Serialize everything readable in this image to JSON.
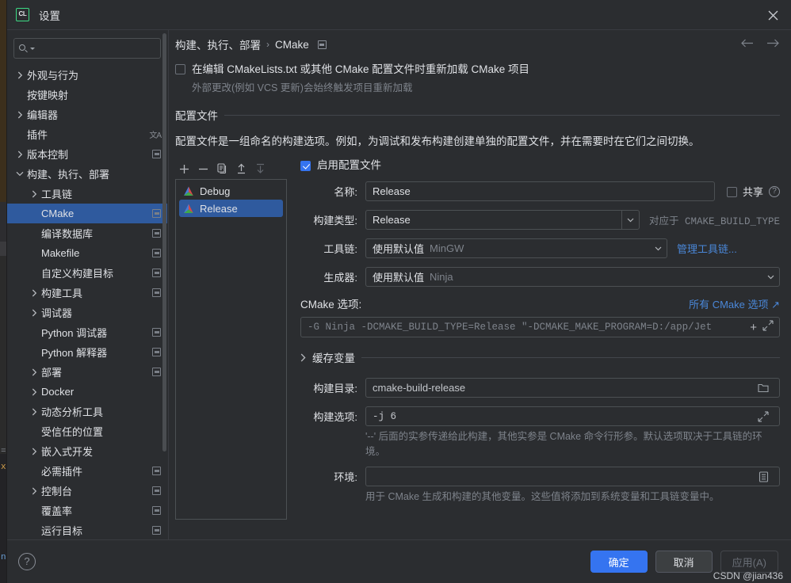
{
  "window": {
    "title": "设置",
    "logo_text": "CL",
    "close_icon": "close-icon"
  },
  "sidebar": {
    "search": {
      "placeholder": "",
      "value": ""
    },
    "items": [
      {
        "label": "外观与行为",
        "indent": 0,
        "arrow": "collapsed",
        "badge": false
      },
      {
        "label": "按键映射",
        "indent": 0,
        "arrow": "none",
        "badge": false
      },
      {
        "label": "编辑器",
        "indent": 0,
        "arrow": "collapsed",
        "badge": false
      },
      {
        "label": "插件",
        "indent": 0,
        "arrow": "none",
        "badge": false,
        "lang_badge": "文A"
      },
      {
        "label": "版本控制",
        "indent": 0,
        "arrow": "collapsed",
        "badge": true
      },
      {
        "label": "构建、执行、部署",
        "indent": 0,
        "arrow": "expanded",
        "badge": false
      },
      {
        "label": "工具链",
        "indent": 1,
        "arrow": "collapsed",
        "badge": false
      },
      {
        "label": "CMake",
        "indent": 1,
        "arrow": "none",
        "badge": true,
        "selected": true
      },
      {
        "label": "编译数据库",
        "indent": 1,
        "arrow": "none",
        "badge": true
      },
      {
        "label": "Makefile",
        "indent": 1,
        "arrow": "none",
        "badge": true
      },
      {
        "label": "自定义构建目标",
        "indent": 1,
        "arrow": "none",
        "badge": true
      },
      {
        "label": "构建工具",
        "indent": 1,
        "arrow": "collapsed",
        "badge": true
      },
      {
        "label": "调试器",
        "indent": 1,
        "arrow": "collapsed",
        "badge": false
      },
      {
        "label": "Python 调试器",
        "indent": 1,
        "arrow": "none",
        "badge": true
      },
      {
        "label": "Python 解释器",
        "indent": 1,
        "arrow": "none",
        "badge": true
      },
      {
        "label": "部署",
        "indent": 1,
        "arrow": "collapsed",
        "badge": true
      },
      {
        "label": "Docker",
        "indent": 1,
        "arrow": "collapsed",
        "badge": false
      },
      {
        "label": "动态分析工具",
        "indent": 1,
        "arrow": "collapsed",
        "badge": false
      },
      {
        "label": "受信任的位置",
        "indent": 1,
        "arrow": "none",
        "badge": false
      },
      {
        "label": "嵌入式开发",
        "indent": 1,
        "arrow": "collapsed",
        "badge": false
      },
      {
        "label": "必需插件",
        "indent": 1,
        "arrow": "none",
        "badge": true
      },
      {
        "label": "控制台",
        "indent": 1,
        "arrow": "collapsed",
        "badge": true
      },
      {
        "label": "覆盖率",
        "indent": 1,
        "arrow": "none",
        "badge": true
      },
      {
        "label": "运行目标",
        "indent": 1,
        "arrow": "none",
        "badge": true
      }
    ]
  },
  "breadcrumb": {
    "parent": "构建、执行、部署",
    "separator": "›",
    "current": "CMake",
    "back_icon": "arrow-left-icon",
    "forward_icon": "arrow-right-icon"
  },
  "main": {
    "reload_checkbox": {
      "label": "在编辑 CMakeLists.txt 或其他 CMake 配置文件时重新加载 CMake 项目",
      "checked": false,
      "note": "外部更改(例如 VCS 更新)会始终触发项目重新加载"
    },
    "section": {
      "title": "配置文件",
      "description": "配置文件是一组命名的构建选项。例如，为调试和发布构建创建单独的配置文件，并在需要时在它们之间切换。"
    },
    "toolbar": {
      "add": "+",
      "remove": "−",
      "copy": "copy-icon",
      "move_up": "arrow-up-icon",
      "move_down": "arrow-down-icon"
    },
    "profiles": [
      {
        "name": "Debug",
        "selected": false
      },
      {
        "name": "Release",
        "selected": true
      }
    ],
    "form": {
      "enable_profile": {
        "label": "启用配置文件",
        "checked": true
      },
      "name": {
        "label": "名称:",
        "value": "Release"
      },
      "share": {
        "label": "共享",
        "checked": false,
        "help": "?"
      },
      "build_type": {
        "label": "构建类型:",
        "value": "Release",
        "note": "对应于 CMAKE_BUILD_TYPE"
      },
      "toolchain": {
        "label": "工具链:",
        "value": "使用默认值",
        "muted": "MinGW",
        "link": "管理工具链..."
      },
      "generator": {
        "label": "生成器:",
        "value": "使用默认值",
        "muted": "Ninja"
      },
      "cmake_options": {
        "label": "CMake 选项:",
        "link": "所有 CMake 选项 ↗",
        "value": "-G Ninja -DCMAKE_BUILD_TYPE=Release \"-DCMAKE_MAKE_PROGRAM=D:/app/Jet",
        "plus": "+"
      },
      "cache_variables": {
        "label": "缓存变量",
        "expanded": false
      },
      "build_directory": {
        "label": "构建目录:",
        "value": "cmake-build-release",
        "icon": "folder-icon"
      },
      "build_options": {
        "label": "构建选项:",
        "value": "-j 6",
        "hint": "'--' 后面的实参传递给此构建，其他实参是 CMake 命令行形参。默认选项取决于工具链的环境。"
      },
      "environment": {
        "label": "环境:",
        "value": "",
        "icon": "list-icon",
        "hint": "用于 CMake 生成和构建的其他变量。这些值将添加到系统变量和工具链变量中。"
      }
    }
  },
  "footer": {
    "help_icon": "?",
    "ok": "确定",
    "cancel": "取消",
    "apply": "应用(A)",
    "watermark": "CSDN @jian436"
  },
  "colors": {
    "accent": "#3574f0",
    "selection": "#2f5a9e",
    "link": "#4a87d8",
    "bg": "#2b2d30",
    "border": "#4c5053",
    "text": "#dfe1e5",
    "muted": "#7e838b",
    "logo_green": "#3ddb85"
  }
}
